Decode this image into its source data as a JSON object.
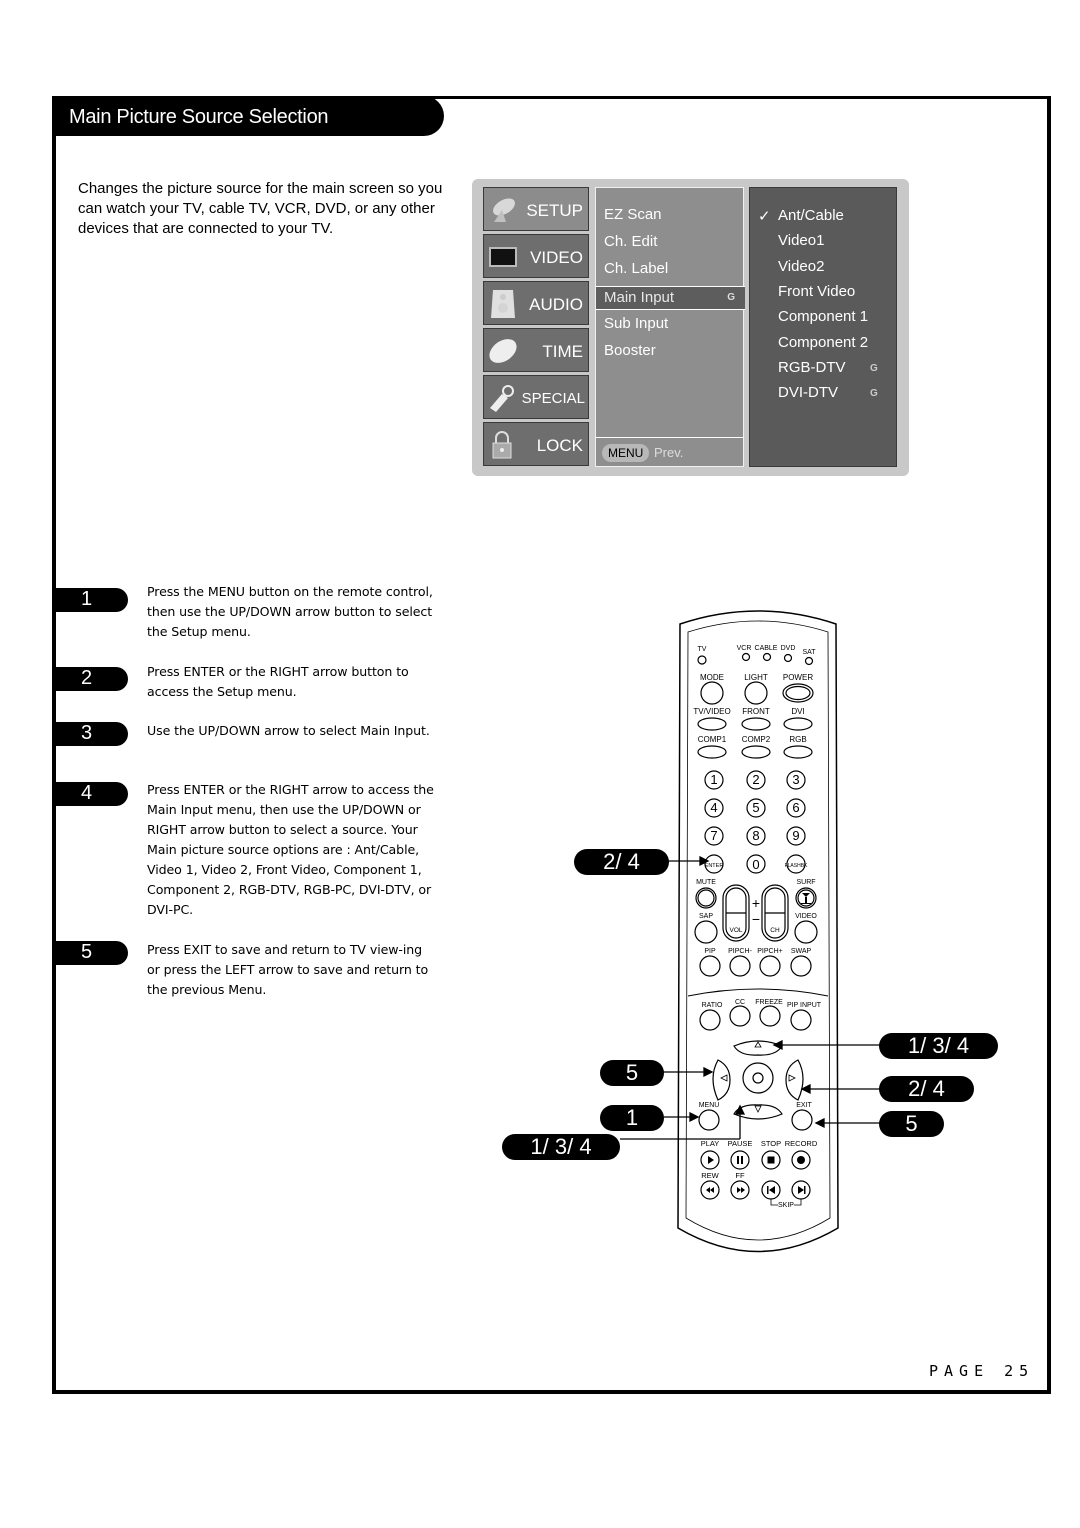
{
  "section_title": "Main Picture Source Selection",
  "intro_text": "Changes the picture source for the main screen so you\ncan watch your TV, cable TV, VCR, DVD, or any other\ndevices that are connected to your TV.",
  "osd_menu": {
    "tabs": [
      {
        "label": "SETUP",
        "icon": "satellite-dish-icon",
        "active": true
      },
      {
        "label": "VIDEO",
        "icon": "tv-screen-icon",
        "active": false
      },
      {
        "label": "AUDIO",
        "icon": "speaker-icon",
        "active": false
      },
      {
        "label": "TIME",
        "icon": "clock-icon",
        "active": false
      },
      {
        "label": "SPECIAL",
        "icon": "tag-icon",
        "active": false
      },
      {
        "label": "LOCK",
        "icon": "padlock-icon",
        "active": false
      }
    ],
    "setup_items": [
      "EZ Scan",
      "Ch. Edit",
      "Ch. Label",
      "Main Input",
      "Sub Input",
      "Booster"
    ],
    "selected_item": "Main Input",
    "selected_marker": "G",
    "footer_button": "MENU",
    "footer_label": "Prev.",
    "input_options": [
      {
        "label": "Ant/Cable",
        "checked": true,
        "marker": ""
      },
      {
        "label": "Video1",
        "checked": false,
        "marker": ""
      },
      {
        "label": "Video2",
        "checked": false,
        "marker": ""
      },
      {
        "label": "Front Video",
        "checked": false,
        "marker": ""
      },
      {
        "label": "Component 1",
        "checked": false,
        "marker": ""
      },
      {
        "label": "Component 2",
        "checked": false,
        "marker": ""
      },
      {
        "label": "RGB-DTV",
        "checked": false,
        "marker": "G"
      },
      {
        "label": "DVI-DTV",
        "checked": false,
        "marker": "G"
      }
    ],
    "check_glyph": "✓"
  },
  "steps": [
    {
      "number": "1",
      "text": "Press the MENU button on the remote control, then use the UP/DOWN arrow button to select the Setup menu."
    },
    {
      "number": "2",
      "text": "Press ENTER or the RIGHT arrow button to access the Setup menu."
    },
    {
      "number": "3",
      "text": "Use the UP/DOWN arrow to select Main Input."
    },
    {
      "number": "4",
      "text": "Press ENTER or the RIGHT arrow to access the Main Input menu, then use the UP/DOWN or RIGHT arrow button to select a source. Your Main picture source options are : Ant/Cable, Video 1, Video 2, Front Video, Component 1, Component 2, RGB-DTV, RGB-PC, DVI-DTV, or DVI-PC."
    },
    {
      "number": "5",
      "text": "Press EXIT to save and return to TV view-ing or press the LEFT arrow to save and return to the previous Menu."
    }
  ],
  "remote": {
    "mode_labels": [
      "TV",
      "VCR",
      "CABLE",
      "DVD",
      "SAT"
    ],
    "row1": [
      "MODE",
      "LIGHT",
      "POWER"
    ],
    "row2": [
      "TV/VIDEO",
      "FRONT",
      "DVI"
    ],
    "row3": [
      "COMP1",
      "COMP2",
      "RGB"
    ],
    "digits": [
      "1",
      "2",
      "3",
      "4",
      "5",
      "6",
      "7",
      "8",
      "9"
    ],
    "enter": "ENTER",
    "zero": "0",
    "flashbk": "FLASHBK",
    "mute": "MUTE",
    "surf": "SURF",
    "sap": "SAP",
    "video": "VIDEO",
    "vol": "VOL",
    "ch": "CH",
    "plus": "+",
    "minus": "−",
    "pip_row": [
      "PIP",
      "PIPCH-",
      "PIPCH+",
      "SWAP"
    ],
    "ratio_row": [
      "RATIO",
      "CC",
      "FREEZE",
      "PIP INPUT"
    ],
    "menu": "MENU",
    "exit": "EXIT",
    "transport_labels": [
      "PLAY",
      "PAUSE",
      "STOP",
      "RECORD"
    ],
    "rew": "REW",
    "ff": "FF",
    "skip": "SKIP"
  },
  "callouts": {
    "enter": "2/ 4",
    "left": "5",
    "menu": "1",
    "down": "1/ 3/ 4",
    "up": "1/ 3/ 4",
    "right": "2/ 4",
    "exit": "5"
  },
  "page_label": "PAGE 25"
}
